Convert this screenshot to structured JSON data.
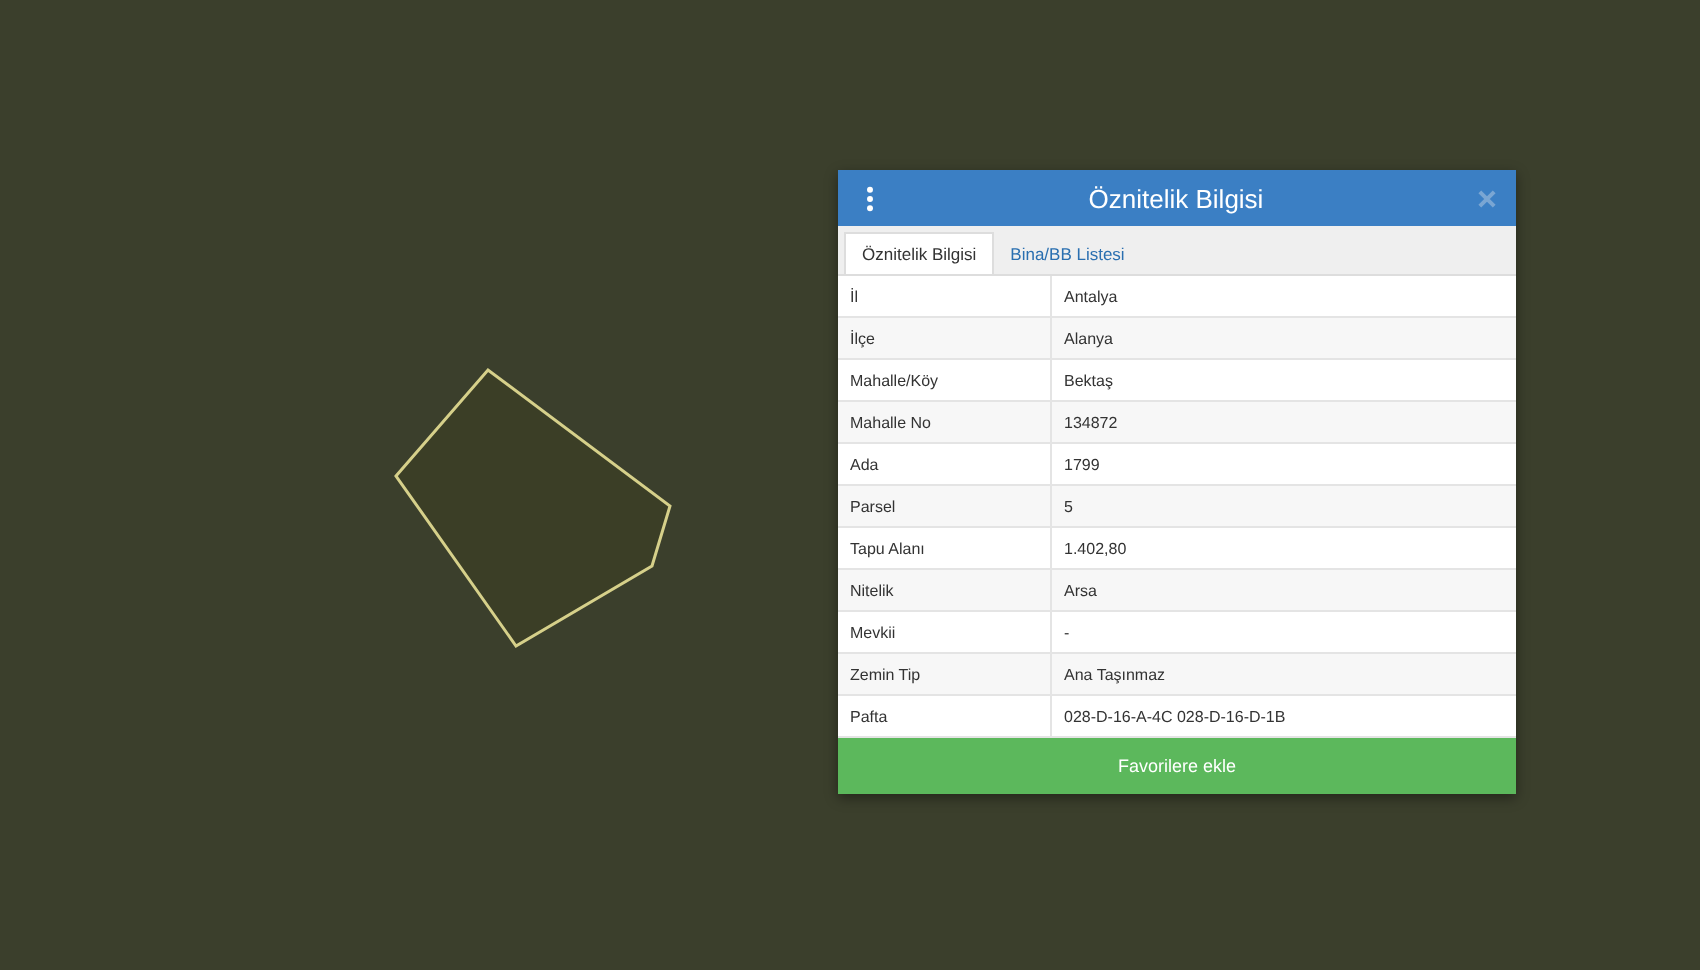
{
  "panel": {
    "title": "Öznitelik Bilgisi",
    "tabs": [
      {
        "label": "Öznitelik Bilgisi",
        "selected": true
      },
      {
        "label": "Bina/BB Listesi",
        "selected": false
      }
    ],
    "rows": [
      {
        "label": "İl",
        "value": "Antalya"
      },
      {
        "label": "İlçe",
        "value": "Alanya"
      },
      {
        "label": "Mahalle/Köy",
        "value": "Bektaş"
      },
      {
        "label": "Mahalle No",
        "value": "134872"
      },
      {
        "label": "Ada",
        "value": "1799"
      },
      {
        "label": "Parsel",
        "value": "5"
      },
      {
        "label": "Tapu Alanı",
        "value": "1.402,80"
      },
      {
        "label": "Nitelik",
        "value": "Arsa"
      },
      {
        "label": "Mevkii",
        "value": "-"
      },
      {
        "label": "Zemin Tip",
        "value": "Ana Taşınmaz"
      },
      {
        "label": "Pafta",
        "value": "028-D-16-A-4C 028-D-16-D-1B"
      }
    ],
    "button": "Favorilere ekle"
  }
}
